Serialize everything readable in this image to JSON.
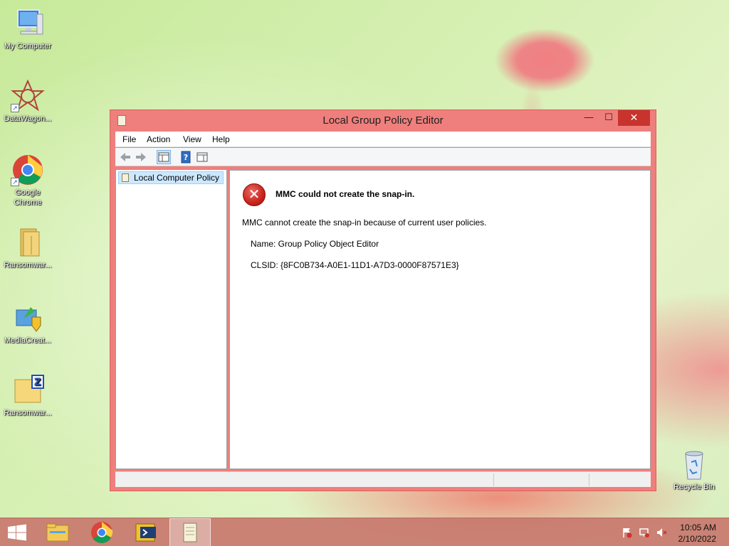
{
  "desktop": {
    "icons": [
      {
        "label": "My Computer",
        "icon": "computer-icon"
      },
      {
        "label": "DataWagon...",
        "icon": "datawagon-icon"
      },
      {
        "label": "Google Chrome",
        "icon": "chrome-icon"
      },
      {
        "label": "Ransomwar...",
        "icon": "folder-icon"
      },
      {
        "label": "MediaCreat...",
        "icon": "media-creation-icon"
      },
      {
        "label": "Ransomwar...",
        "icon": "zip-folder-icon"
      },
      {
        "label": "Recycle Bin",
        "icon": "recycle-bin-icon"
      }
    ]
  },
  "window": {
    "title": "Local Group Policy Editor",
    "controls": {
      "minimize": "—",
      "maximize": "☐",
      "close": "✕"
    },
    "menu": [
      "File",
      "Action",
      "View",
      "Help"
    ],
    "toolbar": [
      "back-arrow-icon",
      "forward-arrow-icon",
      "show-hide-tree-icon",
      "help-icon",
      "action-pane-icon"
    ],
    "tree": {
      "selected": "Local Computer Policy"
    },
    "error": {
      "title": "MMC could not create the snap-in.",
      "message": "MMC cannot create the snap-in because of current user policies.",
      "name": "Name: Group Policy Object Editor",
      "clsid": "CLSID: {8FC0B734-A0E1-11D1-A7D3-0000F87571E3}"
    }
  },
  "taskbar": {
    "items": [
      "start-button",
      "file-explorer",
      "google-chrome",
      "powershell",
      "notepad"
    ],
    "clock": {
      "time": "10:05 AM",
      "date": "2/10/2022"
    }
  },
  "colors": {
    "window_border": "#ef7f7c",
    "close_button": "#c7342d",
    "taskbar": "#c8786e",
    "selection": "#cce8ff"
  }
}
